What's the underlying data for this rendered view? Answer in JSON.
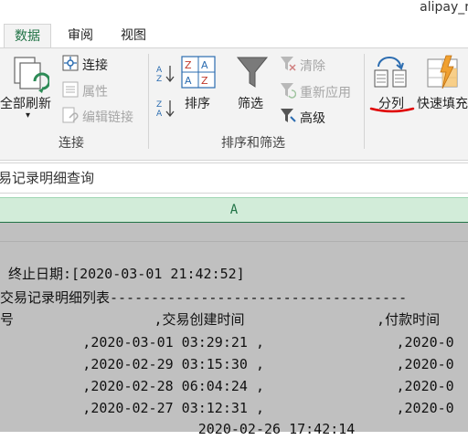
{
  "window": {
    "title": "alipay_r"
  },
  "tabs": [
    {
      "label": "数据",
      "active": true
    },
    {
      "label": "审阅",
      "active": false
    },
    {
      "label": "视图",
      "active": false
    }
  ],
  "ribbon": {
    "refresh_all": "全部刷新",
    "connections": "连接",
    "properties": "属性",
    "edit_links": "编辑链接",
    "group_connections": "连接",
    "sort": "排序",
    "filter": "筛选",
    "clear": "清除",
    "reapply": "重新应用",
    "advanced": "高级",
    "group_sort_filter": "排序和筛选",
    "text_to_columns": "分列",
    "flash_fill": "快速填充"
  },
  "formula_bar": {
    "content": "易记录明细查询"
  },
  "sheet": {
    "column_header": "A",
    "rows": [
      "",
      " 终止日期:[2020-03-01 21:42:52]",
      "交易记录明细列表------------------------------------",
      "号                 ,交易创建时间                ,付款时间",
      "          ,2020-03-01 03:29:21 ,                ,2020-0",
      "          ,2020-02-29 03:15:30 ,                ,2020-0",
      "          ,2020-02-28 06:04:24 ,                ,2020-0",
      "          ,2020-02-27 03:12:31 ,                ,2020-0",
      "                        2020-02-26 17:42:14"
    ]
  },
  "colors": {
    "accent": "#217346",
    "header_fill": "#d2ecd9",
    "sheet_fill": "#c0c0c0",
    "annotation": "#e00000"
  }
}
